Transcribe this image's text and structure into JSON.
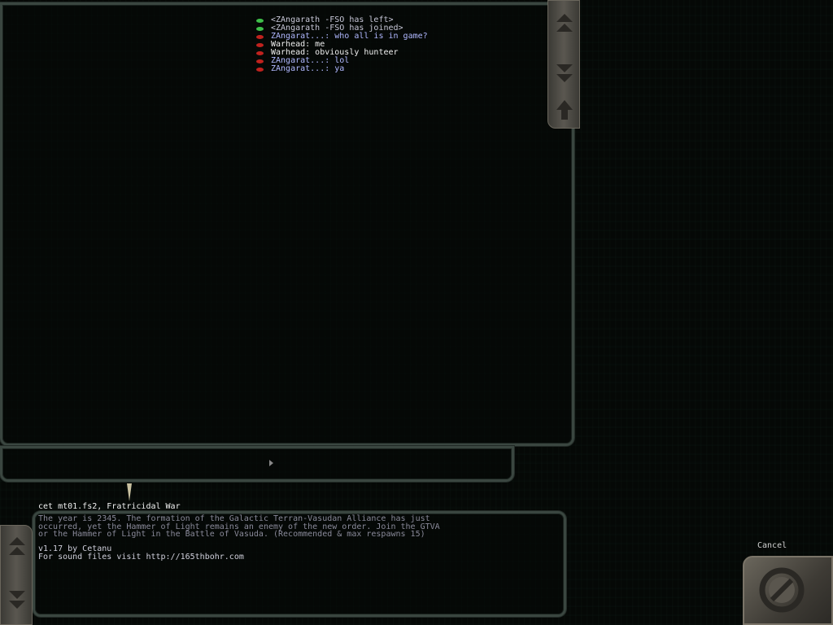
{
  "chat": {
    "messages": [
      {
        "status": "green",
        "text": "<ZAngarath -FSO has left>",
        "color": "#c8c8d8"
      },
      {
        "status": "green",
        "text": "<ZAngarath -FSO has joined>",
        "color": "#c8c8d8"
      },
      {
        "status": "red",
        "text": "ZAngarat...: who all is in game?",
        "color": "#b0b8ff"
      },
      {
        "status": "red",
        "text": "Warhead: me",
        "color": "#f0f0f0"
      },
      {
        "status": "red",
        "text": "Warhead: obviously hunteer",
        "color": "#f0f0f0"
      },
      {
        "status": "red",
        "text": "ZAngarat...: lol",
        "color": "#b0b8ff"
      },
      {
        "status": "red",
        "text": "ZAngarat...: ya",
        "color": "#b0b8ff"
      }
    ]
  },
  "mission": {
    "title": "cet_mt01.fs2, Fratricidal War",
    "description_lines": [
      "The year is 2345. The formation of the Galactic Terran-Vasudan Alliance has just",
      "occurred, yet the Hammer of Light remains an enemy of the new order. Join the GTVA",
      "or the Hammer of Light in the Battle of Vasuda. (Recommended & max respawns 15)"
    ],
    "credit_lines": [
      "v1.17 by Cetanu",
      "For sound files visit http://165thbohr.com"
    ]
  },
  "buttons": {
    "cancel_label": "Cancel"
  },
  "icons": {
    "scroll_up": "double-up-arrow-icon",
    "scroll_down": "double-down-arrow-icon",
    "send": "up-arrow-icon",
    "cancel": "cancel-circle-icon"
  }
}
